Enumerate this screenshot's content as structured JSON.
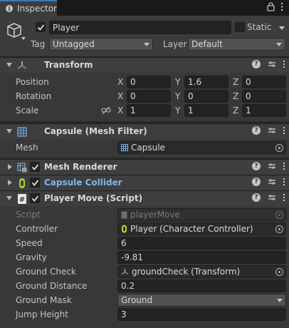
{
  "tab": {
    "label": "Inspector"
  },
  "gameobject": {
    "name": "Player",
    "static_label": "Static",
    "tag_label": "Tag",
    "tag_value": "Untagged",
    "layer_label": "Layer",
    "layer_value": "Default"
  },
  "transform": {
    "title": "Transform",
    "rows": [
      {
        "label": "Position",
        "x": "0",
        "y": "1.6",
        "z": "0"
      },
      {
        "label": "Rotation",
        "x": "0",
        "y": "0",
        "z": "0"
      },
      {
        "label": "Scale",
        "x": "1",
        "y": "1",
        "z": "1"
      }
    ],
    "axes": {
      "x": "X",
      "y": "Y",
      "z": "Z"
    }
  },
  "mesh_filter": {
    "title": "Capsule (Mesh Filter)",
    "mesh_label": "Mesh",
    "mesh_value": "Capsule"
  },
  "mesh_renderer": {
    "title": "Mesh Renderer"
  },
  "capsule_collider": {
    "title": "Capsule Collider"
  },
  "player_move": {
    "title": "Player Move (Script)",
    "fields": {
      "script_label": "Script",
      "script_value": "playerMove",
      "controller_label": "Controller",
      "controller_value": "Player (Character Controller)",
      "speed_label": "Speed",
      "speed_value": "6",
      "gravity_label": "Gravity",
      "gravity_value": "-9.81",
      "ground_check_label": "Ground Check",
      "ground_check_value": "groundCheck (Transform)",
      "ground_distance_label": "Ground Distance",
      "ground_distance_value": "0.2",
      "ground_mask_label": "Ground Mask",
      "ground_mask_value": "Ground",
      "jump_height_label": "Jump Height",
      "jump_height_value": "3"
    }
  },
  "colors": {
    "accent": "#3a79bb",
    "panel": "#383838",
    "header": "#3e3e3e",
    "field": "#232323",
    "collider_title": "#7fb7f0",
    "controller_icon": "#a6d13a"
  },
  "icons": [
    "info-icon",
    "lock-icon",
    "menu-icon",
    "gameobject-cube-icon",
    "transform-axes-icon",
    "help-icon",
    "preset-icon",
    "kebab-icon",
    "mesh-filter-grid-icon",
    "mesh-renderer-icon",
    "capsule-collider-icon",
    "script-icon",
    "object-picker-icon",
    "link-scale-icon"
  ]
}
